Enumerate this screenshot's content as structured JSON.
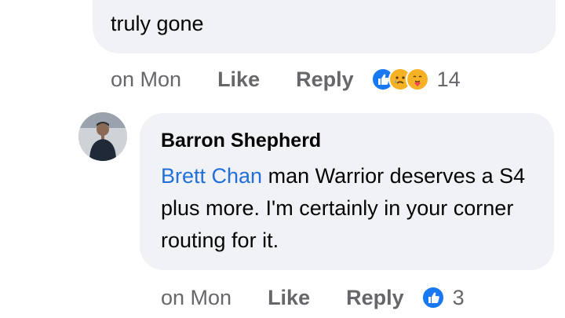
{
  "previous_comment": {
    "text_tail": "truly gone",
    "time": "on Mon",
    "like_label": "Like",
    "reply_label": "Reply",
    "reaction_icons": [
      "like-reaction-icon",
      "sad-reaction-icon",
      "care-reaction-icon"
    ],
    "reaction_count": "14"
  },
  "reply_comment": {
    "author": "Barron Shepherd",
    "mention": "Brett Chan",
    "text": " man  Warrior deserves a S4 plus more. I'm certainly in your corner routing for it.",
    "time": "on Mon",
    "like_label": "Like",
    "reply_label": "Reply",
    "reaction_icons": [
      "like-reaction-icon"
    ],
    "reaction_count": "3"
  },
  "colors": {
    "bubble": "#f0f2f5",
    "mention": "#216fdb",
    "meta_text": "#65676b",
    "like_blue": "#1877f2",
    "emoji_yellow": "#f7b125"
  }
}
